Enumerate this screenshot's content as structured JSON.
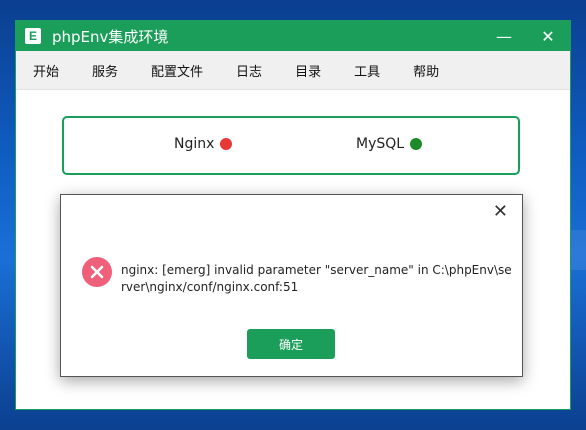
{
  "window": {
    "app_icon_letter": "E",
    "title": "phpEnv集成环境",
    "minimize_glyph": "—",
    "close_glyph": "✕"
  },
  "menu": {
    "items": [
      "开始",
      "服务",
      "配置文件",
      "日志",
      "目录",
      "工具",
      "帮助"
    ]
  },
  "services": [
    {
      "name": "Nginx",
      "status_color": "#e53935"
    },
    {
      "name": "MySQL",
      "status_color": "#1a8a2a"
    }
  ],
  "dialog": {
    "close_glyph": "✕",
    "icon": "error-x-icon",
    "message": "nginx: [emerg] invalid parameter \"server_name\" in C:\\phpEnv\\server\\nginx/conf/nginx.conf:51",
    "ok_label": "确定"
  },
  "colors": {
    "accent": "#1a9e5a",
    "error": "#f0607a",
    "desktop": "#0f5cc0"
  }
}
